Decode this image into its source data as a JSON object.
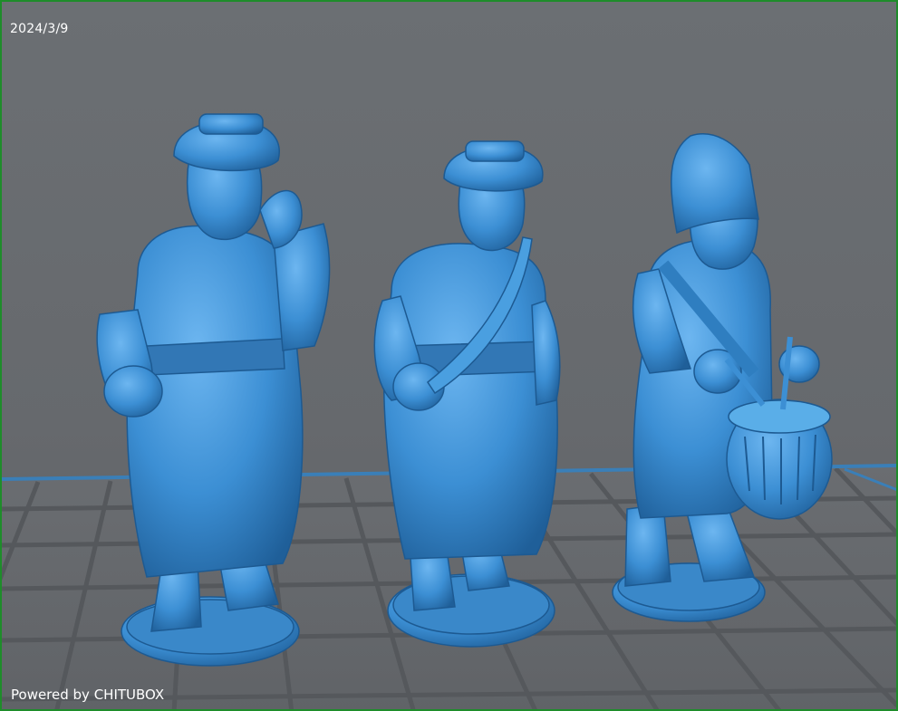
{
  "viewport": {
    "date": "2024/3/9",
    "watermark": "Powered by CHITUBOX"
  },
  "colors": {
    "background": "#666a6e",
    "grid_line": "#56595d",
    "platform_edge": "#3a7fb8",
    "model": "#3c8fd4",
    "window_border": "#1e8c2a"
  },
  "models": [
    {
      "id": "figure-turban-saluting"
    },
    {
      "id": "figure-turban-horn"
    },
    {
      "id": "figure-drummer"
    }
  ]
}
